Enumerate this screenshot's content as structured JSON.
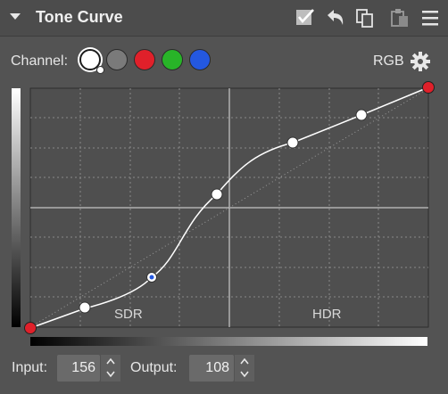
{
  "panel": {
    "title": "Tone Curve",
    "header_icons": [
      "checkbox-icon",
      "undo-icon",
      "copy-icon",
      "paste-icon",
      "menu-icon"
    ]
  },
  "channel": {
    "label": "Channel:",
    "options": [
      {
        "name": "luminance",
        "color": "#ffffff",
        "selected": true
      },
      {
        "name": "gray",
        "color": "#7a7a7a",
        "selected": false
      },
      {
        "name": "red",
        "color": "#e0202a",
        "selected": false
      },
      {
        "name": "green",
        "color": "#28b428",
        "selected": false
      },
      {
        "name": "blue",
        "color": "#2458e0",
        "selected": false
      }
    ],
    "mode_label": "RGB"
  },
  "curve": {
    "zone_left": "SDR",
    "zone_right": "HDR"
  },
  "io": {
    "input_label": "Input:",
    "input_value": "156",
    "output_label": "Output:",
    "output_value": "108"
  }
}
